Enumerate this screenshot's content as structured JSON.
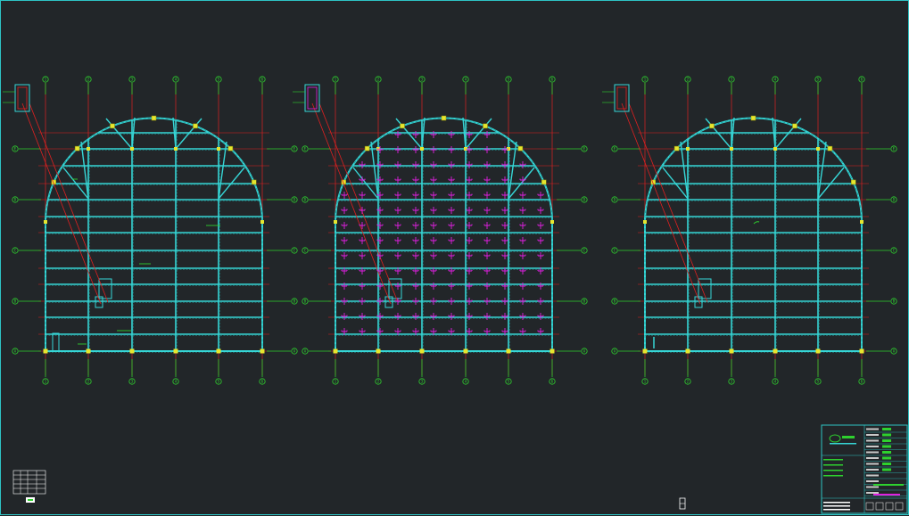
{
  "drawing": {
    "colors": {
      "background": "#222629",
      "frame": "#2ec4c4",
      "beam": "#36d6d6",
      "grid_line": "#e02020",
      "axis_green": "#2ed12e",
      "column_yellow": "#e6e62e",
      "rebar_magenta": "#e020e0",
      "white": "#ffffff"
    },
    "plans": [
      {
        "name": "plan-1",
        "rebar": false
      },
      {
        "name": "plan-2",
        "rebar": true
      },
      {
        "name": "plan-3",
        "rebar": false
      }
    ],
    "axis_labels_vertical": [
      "1",
      "2",
      "3",
      "4",
      "5",
      "6"
    ],
    "axis_labels_horizontal": [
      "F",
      "E",
      "D",
      "C",
      "B",
      "A"
    ],
    "title_block": {
      "company_logo": "company-logo"
    }
  }
}
